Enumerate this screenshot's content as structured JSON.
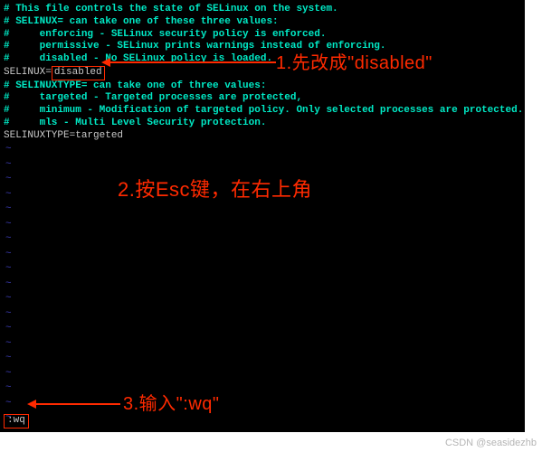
{
  "config": {
    "l1": "# This file controls the state of SELinux on the system.",
    "l2": "# SELINUX= can take one of these three values:",
    "l3": "#     enforcing - SELinux security policy is enforced.",
    "l4": "#     permissive - SELinux prints warnings instead of enforcing.",
    "l5": "#     disabled - No SELinux policy is loaded.",
    "l6_prefix": "SELINUX=",
    "l6_value": "disabled",
    "l7": "# SELINUXTYPE= can take one of three values:",
    "l8": "#     targeted - Targeted processes are protected,",
    "l9": "#     minimum - Modification of targeted policy. Only selected processes are protected.",
    "l10": "#     mls - Multi Level Security protection.",
    "l11": "SELINUXTYPE=targeted"
  },
  "tilde": "~",
  "command": ":wq",
  "annotations": {
    "a1": "1.先改成\"disabled\"",
    "a2": "2.按Esc键，在右上角",
    "a3": "3.输入\":wq\""
  },
  "watermark": "CSDN @seasidezhb"
}
